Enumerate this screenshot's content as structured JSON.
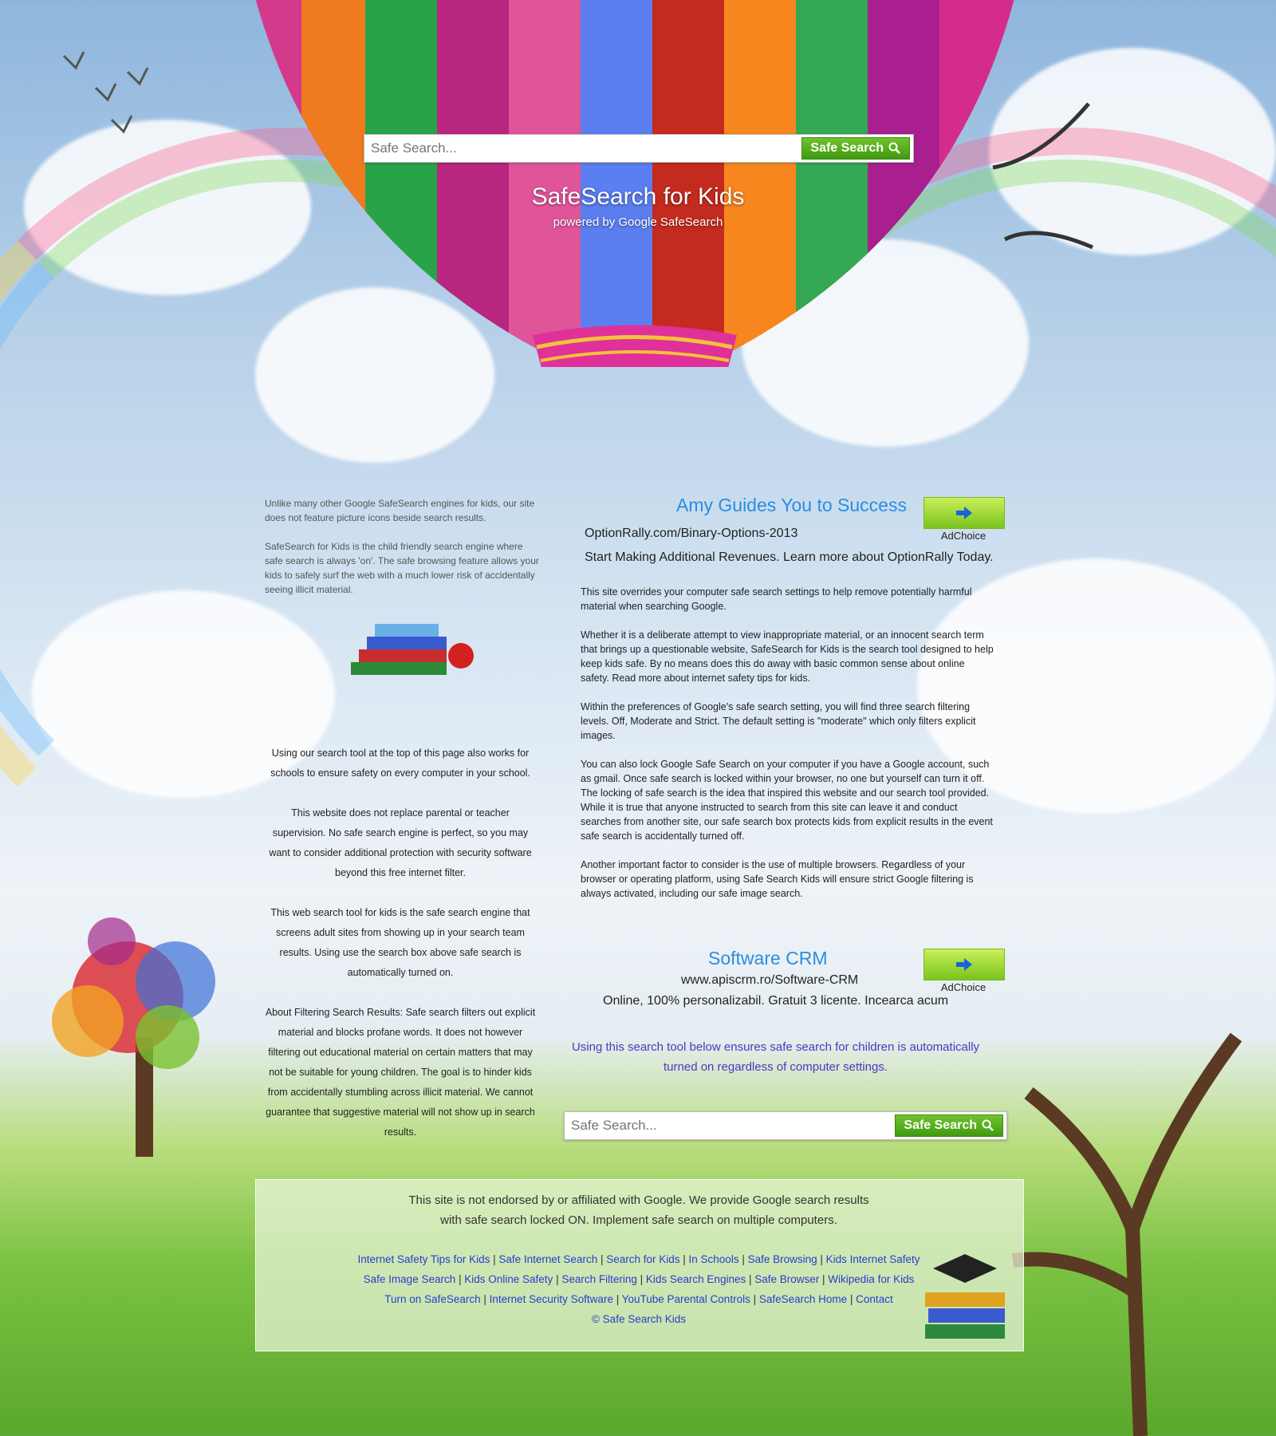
{
  "top_search": {
    "placeholder": "Safe Search...",
    "button_label": "Safe Search"
  },
  "header": {
    "title": "SafeSearch for Kids",
    "subtitle": "powered by Google SafeSearch"
  },
  "left_intro": [
    "Unlike many other Google SafeSearch engines for kids, our site does not feature picture icons beside search results.",
    "SafeSearch for Kids is the child friendly search engine where safe search is always 'on'. The safe browsing feature allows your kids to safely surf the web with a much lower risk of accidentally seeing illicit material."
  ],
  "left_center": [
    "Using our search tool at the top of this page also works for schools to ensure safety on every computer in your school.",
    "This website does not replace parental or teacher supervision.  No safe search engine is perfect, so you may want to consider additional protection with security software beyond this free internet filter.",
    "This web search tool for kids is the safe search engine that screens adult sites from showing up in your search team results. Using use the search box above safe search is automatically turned on.",
    "About Filtering Search Results:  Safe search filters out explicit material and blocks profane words. It does not however filtering out educational material on certain matters that may not be suitable for young children. The goal is to hinder kids from accidentally stumbling across illicit material. We cannot guarantee that suggestive material will not show up in search results."
  ],
  "ad1": {
    "title": "Amy Guides You to Success",
    "url": "OptionRally.com/Binary-Options-2013",
    "text": "Start Making Additional Revenues. Learn more about OptionRally Today.",
    "adchoice": "AdChoice"
  },
  "main_paragraphs": [
    "This site overrides your computer safe search settings to help remove potentially harmful material when searching Google.",
    "Whether it is a deliberate attempt to view inappropriate material, or an innocent search term that brings up a questionable website, SafeSearch for Kids is the search tool designed to help keep kids safe. By no means does this do away with basic common sense about online safety. Read more about internet safety tips for kids.",
    "Within the preferences of Google's safe search setting, you will find three search filtering levels. Off, Moderate and Strict. The default setting is \"moderate\" which only filters explicit images.",
    "You can also lock Google Safe Search on your computer if you have a Google account, such as gmail. Once safe search is locked within your browser, no one but yourself can turn it off. The locking of safe search is the idea that inspired this website and our search tool provided. While it is true that anyone instructed to search from this site can leave it and conduct searches from another site, our safe search box protects kids from explicit results in the event safe search is accidentally turned off.",
    "Another important factor to consider is the use of multiple browsers. Regardless of your browser or operating platform, using Safe Search Kids will ensure strict Google filtering is always activated, including our safe image search."
  ],
  "ad2": {
    "title": "Software CRM",
    "url": "www.apiscrm.ro/Software-CRM",
    "text": "Online, 100% personalizabil. Gratuit 3 licente. Incearca acum",
    "adchoice": "AdChoice"
  },
  "bottom_note": "Using this search tool below ensures safe search for children is automatically turned on regardless of computer settings.",
  "bottom_search": {
    "placeholder": "Safe Search...",
    "button_label": "Safe Search"
  },
  "footer": {
    "disclaimer_line1": "This site is not endorsed by or affiliated with Google.  We provide Google search results",
    "disclaimer_line2": "with safe search locked ON.  Implement safe search on multiple computers.",
    "links_row1": [
      "Internet Safety Tips for Kids",
      "Safe Internet Search",
      "Search for Kids",
      "In Schools",
      "Safe Browsing",
      "Kids Internet Safety"
    ],
    "links_row2": [
      "Safe Image Search",
      "Kids Online Safety",
      "Search Filtering",
      "Kids Search Engines",
      "Safe Browser",
      "Wikipedia for Kids"
    ],
    "links_row3": [
      "Turn on SafeSearch",
      "Internet Security Software",
      "YouTube Parental Controls",
      "SafeSearch Home",
      "Contact"
    ],
    "copyright": "© Safe Search Kids"
  },
  "colors": {
    "ad_title": "#2a8de0",
    "link": "#2b3bd0",
    "note": "#5035c8",
    "button_green": "#4aa516"
  }
}
